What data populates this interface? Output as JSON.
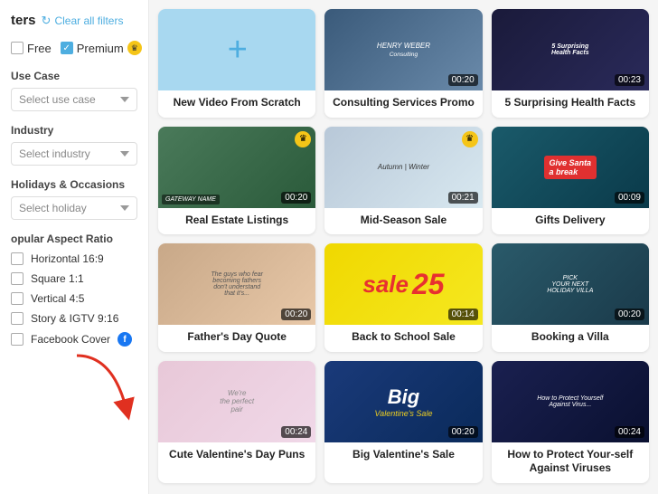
{
  "sidebar": {
    "filters_label": "ters",
    "clear_filters_label": "Clear all filters",
    "tier_free_label": "Free",
    "tier_premium_label": "Premium",
    "use_case_section": "Use Case",
    "use_case_placeholder": "Select use case",
    "industry_section": "Industry",
    "industry_placeholder": "Select industry",
    "holidays_section": "Holidays & Occasions",
    "holidays_placeholder": "Select holiday",
    "aspect_ratio_section": "opular Aspect Ratio",
    "ar_options": [
      {
        "label": "Horizontal 16:9",
        "id": "h169"
      },
      {
        "label": "Square 1:1",
        "id": "sq11"
      },
      {
        "label": "Vertical 4:5",
        "id": "v45"
      },
      {
        "label": "Story & IGTV 9:16",
        "id": "s916"
      },
      {
        "label": "Facebook Cover",
        "id": "fbcover"
      }
    ]
  },
  "cards": [
    {
      "id": "new-video",
      "label": "New Video From Scratch",
      "type": "new",
      "thumb_bg": "lightblue",
      "time": null,
      "premium": false
    },
    {
      "id": "consulting",
      "label": "Consulting Services Promo",
      "type": "video",
      "thumb_bg": "consulting",
      "time": "00:20",
      "premium": false
    },
    {
      "id": "health-facts",
      "label": "5 Surprising Health Facts",
      "type": "video",
      "thumb_bg": "health",
      "time": "00:23",
      "premium": false
    },
    {
      "id": "real-estate",
      "label": "Real Estate Listings",
      "type": "video",
      "thumb_bg": "aerial",
      "time": "00:20",
      "premium": true
    },
    {
      "id": "mid-season",
      "label": "Mid-Season Sale",
      "type": "video",
      "thumb_bg": "fashion",
      "time": "00:21",
      "premium": true
    },
    {
      "id": "gifts-delivery",
      "label": "Gifts Delivery",
      "type": "video",
      "thumb_bg": "givesanta",
      "time": "00:09",
      "premium": false
    },
    {
      "id": "fathers-day",
      "label": "Father's Day Quote",
      "type": "video",
      "thumb_bg": "family",
      "time": "00:20",
      "premium": false
    },
    {
      "id": "back-school",
      "label": "Back to School Sale",
      "type": "video",
      "thumb_bg": "sale",
      "time": "00:14",
      "premium": false
    },
    {
      "id": "booking-villa",
      "label": "Booking a Villa",
      "type": "video",
      "thumb_bg": "villa",
      "time": "00:20",
      "premium": false
    },
    {
      "id": "valentines-puns",
      "label": "Cute Valentine's Day Puns",
      "type": "video",
      "thumb_bg": "valentines",
      "time": "00:24",
      "premium": false
    },
    {
      "id": "big-valentine",
      "label": "Big Valentine's Sale",
      "type": "video",
      "thumb_bg": "bigval",
      "time": "00:20",
      "premium": false
    },
    {
      "id": "protect-virus",
      "label": "How to Protect Your-self Against Viruses",
      "type": "video",
      "thumb_bg": "virus",
      "time": "00:24",
      "premium": false
    }
  ]
}
